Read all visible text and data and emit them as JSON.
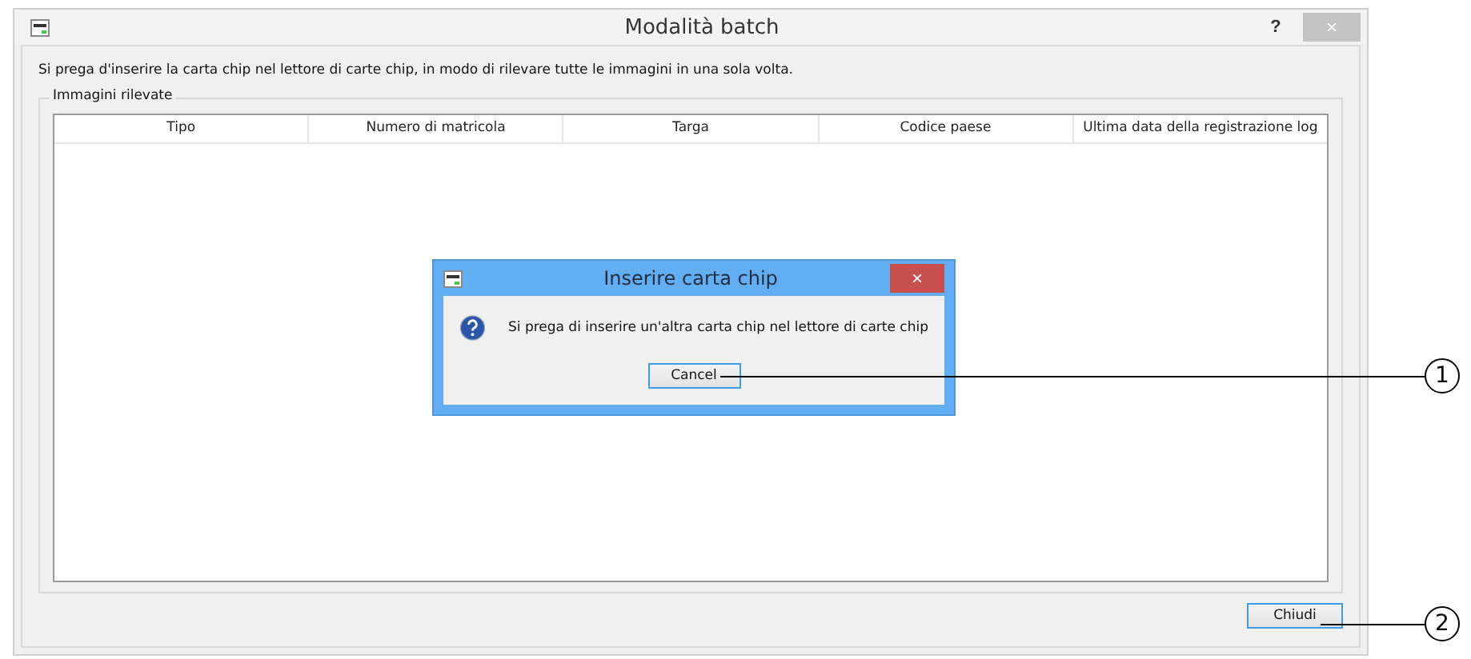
{
  "window": {
    "title": "Modalità batch",
    "help": "?",
    "close": "×"
  },
  "instruction": "Si prega d'inserire la carta chip nel lettore di carte chip, in modo di rilevare tutte le immagini in una sola volta.",
  "group": {
    "label": "Immagini rilevate"
  },
  "table": {
    "columns": [
      "Tipo",
      "Numero di matricola",
      "Targa",
      "Codice paese",
      "Ultima data della registrazione log"
    ]
  },
  "dialog": {
    "title": "Inserire carta chip",
    "close": "×",
    "message": "Si prega di inserire un'altra carta chip nel lettore di carte chip",
    "button": "Cancel"
  },
  "close_button": "Chiudi",
  "callouts": [
    "1",
    "2"
  ]
}
